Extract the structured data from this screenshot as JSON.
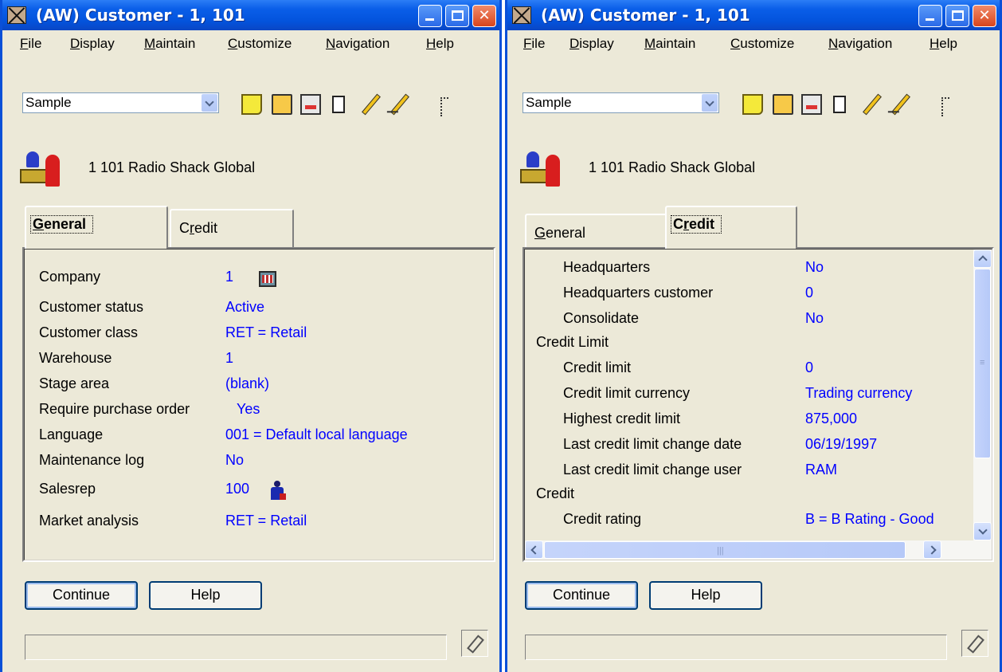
{
  "windows": [
    {
      "title": "(AW) Customer - 1, 101",
      "menu": [
        "File",
        "Display",
        "Maintain",
        "Customize",
        "Navigation",
        "Help"
      ],
      "view_selected": "Sample",
      "header_text": "1   101   Radio Shack Global",
      "tabs": [
        {
          "label": "General",
          "active": true
        },
        {
          "label": "Credit",
          "active": false
        }
      ],
      "fields": [
        {
          "label": "Company",
          "value": "1",
          "icon": "company-icon"
        },
        {
          "label": "Customer status",
          "value": "Active"
        },
        {
          "label": "Customer class",
          "value": "RET = Retail"
        },
        {
          "label": "Warehouse",
          "value": "1"
        },
        {
          "label": "Stage area",
          "value": "(blank)"
        },
        {
          "label": "Require purchase order",
          "value": "Yes"
        },
        {
          "label": "Language",
          "value": "001 = Default local language"
        },
        {
          "label": "Maintenance log",
          "value": "No"
        },
        {
          "label": "Salesrep",
          "value": "100",
          "icon": "salesrep-icon"
        },
        {
          "label": "Market analysis",
          "value": "RET = Retail"
        }
      ],
      "buttons": {
        "continue": "Continue",
        "help": "Help"
      }
    },
    {
      "title": "(AW) Customer - 1, 101",
      "menu": [
        "File",
        "Display",
        "Maintain",
        "Customize",
        "Navigation",
        "Help"
      ],
      "view_selected": "Sample",
      "header_text": "1   101   Radio Shack Global",
      "tabs": [
        {
          "label": "General",
          "active": false
        },
        {
          "label": "Credit",
          "active": true
        }
      ],
      "fields": [
        {
          "label": "Headquarters",
          "value": "No",
          "indent": true
        },
        {
          "label": "Headquarters customer",
          "value": "0",
          "indent": true
        },
        {
          "label": "Consolidate",
          "value": "No",
          "indent": true
        },
        {
          "label": "Credit Limit",
          "value": "",
          "indent": false
        },
        {
          "label": "Credit limit",
          "value": "0",
          "indent": true
        },
        {
          "label": "Credit limit currency",
          "value": "Trading currency",
          "indent": true
        },
        {
          "label": "Highest credit limit",
          "value": "875,000",
          "indent": true
        },
        {
          "label": "Last credit limit change date",
          "value": "06/19/1997",
          "indent": true
        },
        {
          "label": "Last credit limit change user",
          "value": "RAM",
          "indent": true
        },
        {
          "label": "Credit",
          "value": "",
          "indent": false
        },
        {
          "label": "Credit rating",
          "value": "B = B Rating - Good",
          "indent": true
        }
      ],
      "buttons": {
        "continue": "Continue",
        "help": "Help"
      }
    }
  ],
  "colors": {
    "title_bar": "#0a5ee8",
    "field_value": "#0000ff",
    "window_bg": "#ece9d8"
  }
}
